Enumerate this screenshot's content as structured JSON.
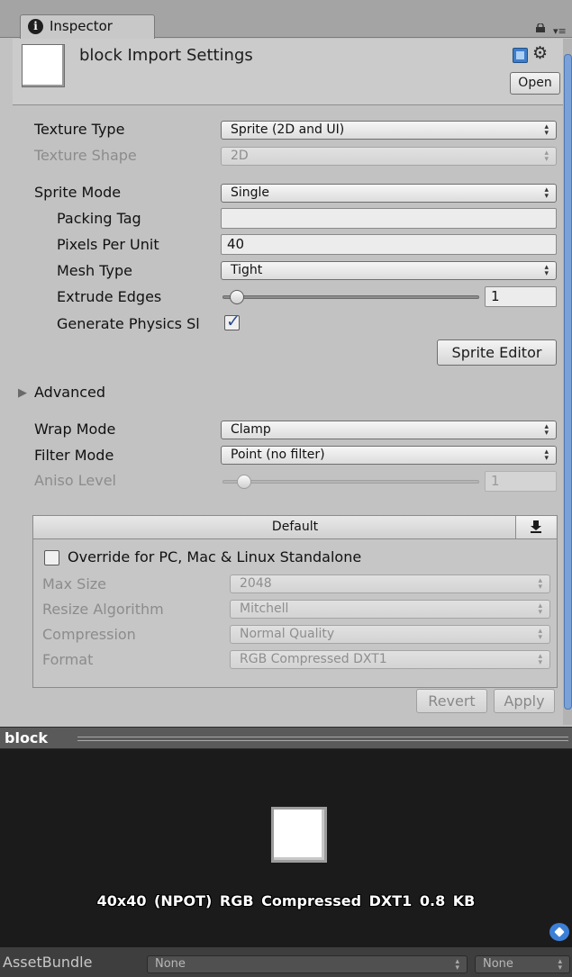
{
  "tab": {
    "title": "Inspector"
  },
  "header": {
    "title": "block Import Settings",
    "open_label": "Open"
  },
  "settings": {
    "texture_type": {
      "label": "Texture Type",
      "value": "Sprite (2D and UI)"
    },
    "texture_shape": {
      "label": "Texture Shape",
      "value": "2D"
    },
    "sprite_mode": {
      "label": "Sprite Mode",
      "value": "Single"
    },
    "packing_tag": {
      "label": "Packing Tag",
      "value": ""
    },
    "pixels_per_unit": {
      "label": "Pixels Per Unit",
      "value": "40"
    },
    "mesh_type": {
      "label": "Mesh Type",
      "value": "Tight"
    },
    "extrude_edges": {
      "label": "Extrude Edges",
      "value": "1",
      "slider_fraction": 0.03
    },
    "generate_physics": {
      "label": "Generate Physics Sl",
      "checked": true
    },
    "sprite_editor_label": "Sprite Editor",
    "advanced_label": "Advanced",
    "wrap_mode": {
      "label": "Wrap Mode",
      "value": "Clamp"
    },
    "filter_mode": {
      "label": "Filter Mode",
      "value": "Point (no filter)"
    },
    "aniso_level": {
      "label": "Aniso Level",
      "value": "1",
      "slider_fraction": 0.06
    }
  },
  "platform": {
    "header_label": "Default",
    "override_label": "Override for PC, Mac & Linux Standalone",
    "override_checked": false,
    "max_size": {
      "label": "Max Size",
      "value": "2048"
    },
    "resize_algorithm": {
      "label": "Resize Algorithm",
      "value": "Mitchell"
    },
    "compression": {
      "label": "Compression",
      "value": "Normal Quality"
    },
    "format": {
      "label": "Format",
      "value": "RGB Compressed DXT1"
    }
  },
  "actions": {
    "revert_label": "Revert",
    "apply_label": "Apply"
  },
  "preview": {
    "title": "block",
    "info": "40x40 (NPOT)  RGB Compressed DXT1   0.8 KB"
  },
  "asset_bundle": {
    "label": "AssetBundle",
    "name_value": "None",
    "variant_value": "None"
  },
  "colors": {
    "panel_bg": "#c2c2c2",
    "preview_bg": "#1b1b1b",
    "accent_blue": "#3c7fd6",
    "check_color": "#2b4d8c"
  },
  "icons": [
    "info-icon",
    "lock-icon",
    "menu-icon",
    "help-icon",
    "gear-icon",
    "foldout-arrow-icon",
    "download-icon",
    "tag-icon",
    "popup-arrows-icon",
    "check-icon"
  ]
}
